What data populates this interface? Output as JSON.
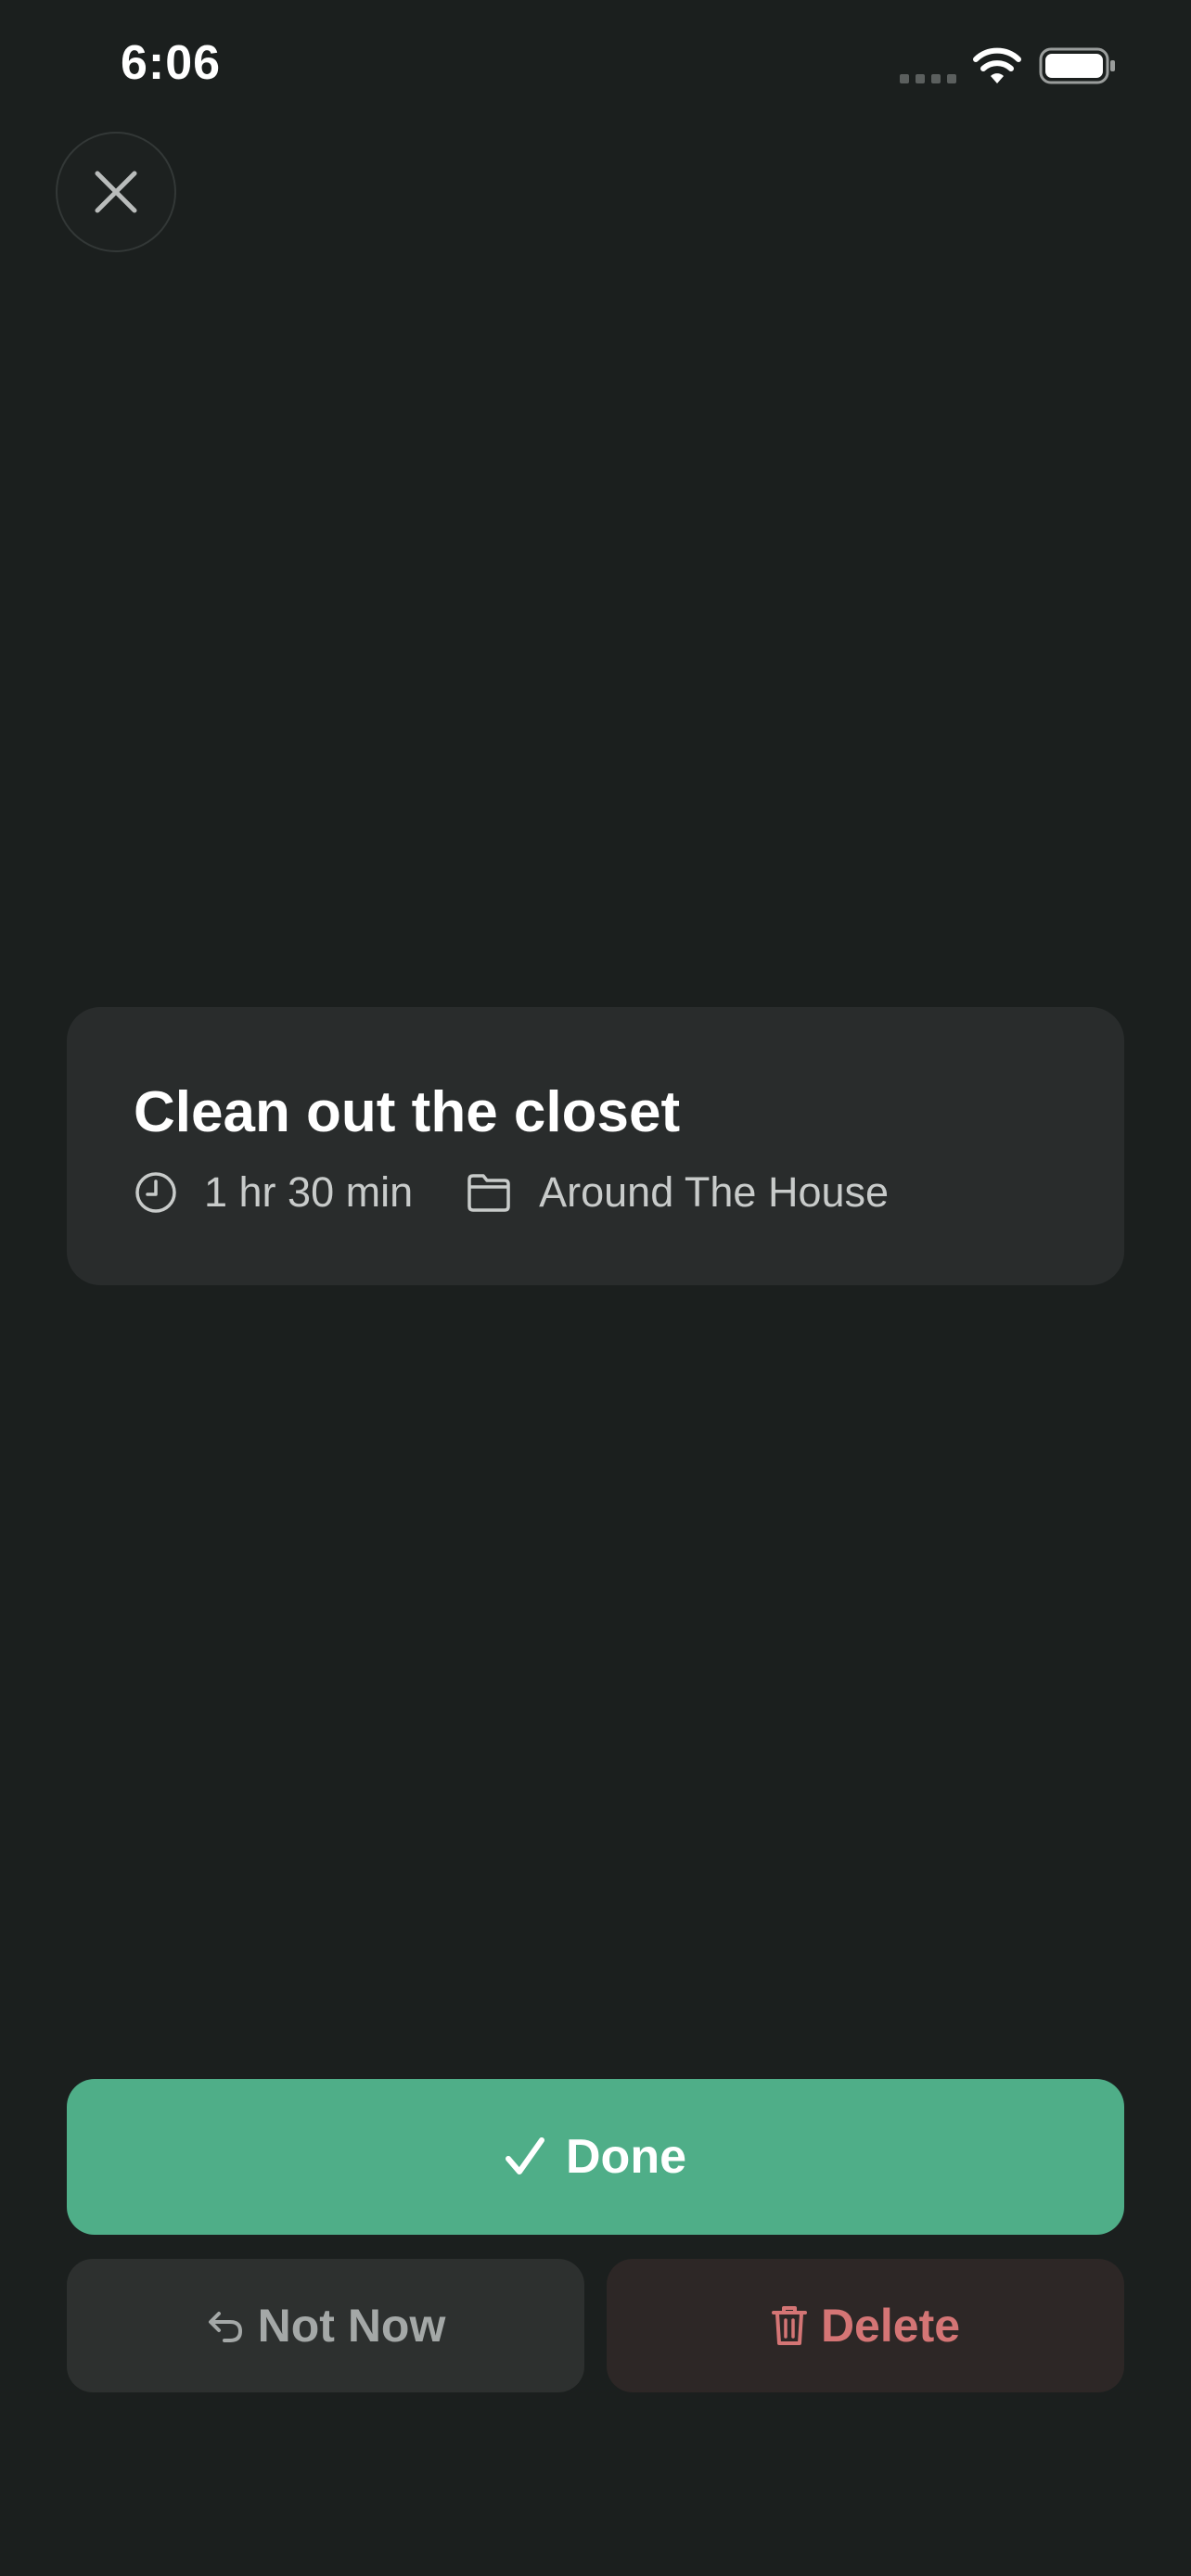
{
  "status_bar": {
    "time": "6:06",
    "icons": [
      "signal-dots-icon",
      "wifi-icon",
      "battery-icon"
    ]
  },
  "close_button": {
    "icon": "close-icon"
  },
  "task": {
    "title": "Clean out the closet",
    "duration": "1 hr 30 min",
    "duration_icon": "clock-icon",
    "project": "Around The House",
    "project_icon": "folder-icon"
  },
  "actions": {
    "done_label": "Done",
    "done_icon": "checkmark-icon",
    "not_now_label": "Not Now",
    "not_now_icon": "undo-arrow-icon",
    "delete_label": "Delete",
    "delete_icon": "trash-icon"
  },
  "colors": {
    "background": "#1b1f1e",
    "card": "#292c2c",
    "done_green": "#4fae88",
    "delete_red": "#d47575"
  }
}
